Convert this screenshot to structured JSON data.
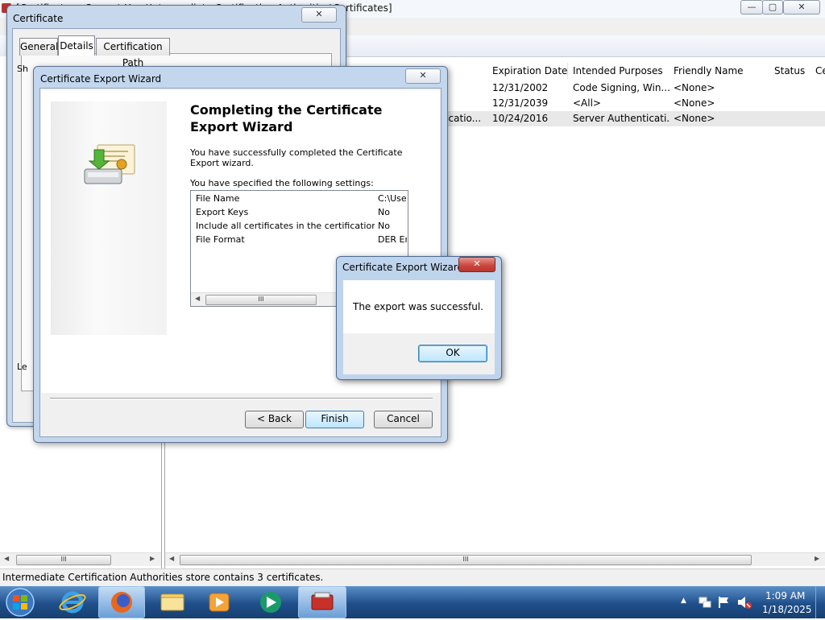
{
  "main_window": {
    "title": "[Certificates - Current User\\Intermediate Certification Authorities\\Certificates]",
    "controls": {
      "minimize": "—",
      "maximize": "▢",
      "close": "✕"
    },
    "columns": [
      "Expiration Date",
      "Intended Purposes",
      "Friendly Name",
      "Status",
      "Ce"
    ],
    "rows": [
      {
        "issued_fragment": "",
        "expiration": "12/31/2002",
        "purposes": "Code Signing, Win...",
        "friendly": "<None>"
      },
      {
        "issued_fragment": "",
        "expiration": "12/31/2039",
        "purposes": "<All>",
        "friendly": "<None>"
      },
      {
        "issued_fragment": "ficatio...",
        "expiration": "10/24/2016",
        "purposes": "Server Authenticati...",
        "friendly": "<None>"
      }
    ],
    "scroll_grip": "III",
    "status_text": "Intermediate Certification Authorities store contains 3 certificates."
  },
  "certificate_dialog": {
    "title": "Certificate",
    "close": "✕",
    "tabs": [
      "General",
      "Details",
      "Certification Path"
    ],
    "left_fragment_1": "Sh",
    "left_fragment_2": "Le"
  },
  "wizard": {
    "title": "Certificate Export Wizard",
    "close": "✕",
    "heading": "Completing the Certificate Export Wizard",
    "success_text": "You have successfully completed the Certificate Export wizard.",
    "settings_label": "You have specified the following settings:",
    "settings": [
      {
        "name": "File Name",
        "value": "C:\\Use"
      },
      {
        "name": "Export Keys",
        "value": "No"
      },
      {
        "name": "Include all certificates in the certification path",
        "value": "No"
      },
      {
        "name": "File Format",
        "value": "DER En"
      }
    ],
    "scroll_grip": "III",
    "buttons": {
      "back": "< Back",
      "finish": "Finish",
      "cancel": "Cancel"
    }
  },
  "message_box": {
    "title": "Certificate Export Wizard",
    "close": "✕",
    "message": "The export was successful.",
    "ok": "OK"
  },
  "taskbar": {
    "time": "1:09 AM",
    "date": "1/18/2025",
    "show_hidden_arrow": "▲"
  },
  "colors": {
    "taskbar": "#1f4f8a",
    "dialog_frame": "#c2d6ee",
    "close_button": "#c9443b"
  }
}
